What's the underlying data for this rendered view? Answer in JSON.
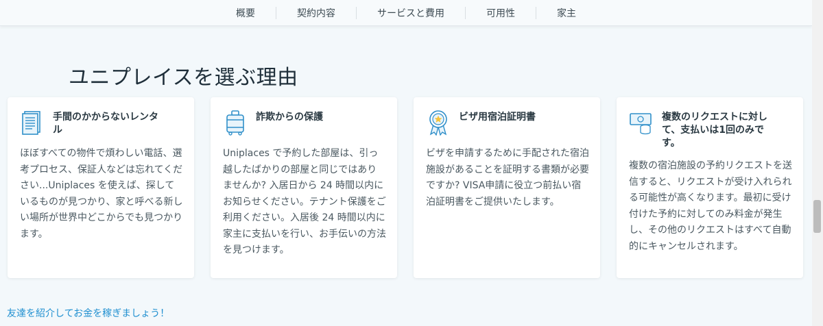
{
  "nav": {
    "items": [
      "概要",
      "契約内容",
      "サービスと費用",
      "可用性",
      "家主"
    ]
  },
  "section": {
    "title": "ユニプレイスを選ぶ理由"
  },
  "cards": [
    {
      "icon": "document-icon",
      "title": "手間のかからないレンタル",
      "body": "ほぼすべての物件で煩わしい電話、選考プロセス、保証人などは忘れてください...Uniplaces を使えば、探しているものが見つかり、家と呼べる新しい場所が世界中どこからでも見つかります。"
    },
    {
      "icon": "luggage-icon",
      "title": "詐欺からの保護",
      "body": "Uniplaces で予約した部屋は、引っ越したばかりの部屋と同じではありませんか? 入居日から 24 時間以内にお知らせください。テナント保護をご利用ください。入居後 24 時間以内に家主に支払いを行い、お手伝いの方法を見つけます。"
    },
    {
      "icon": "award-badge-icon",
      "title": "ビザ用宿泊証明書",
      "body": "ビザを申請するために手配された宿泊施設があることを証明する書類が必要ですか? VISA申請に役立つ前払い宿泊証明書をご提供いたします。"
    },
    {
      "icon": "money-icon",
      "title": "複数のリクエストに対して、支払いは1回のみです。",
      "body": "複数の宿泊施設の予約リクエストを送信すると、リクエストが受け入れられる可能性が高くなります。最初に受け付けた予約に対してのみ料金が発生し、その他のリクエストはすべて自動的にキャンセルされます。"
    }
  ],
  "referral": {
    "label": "友達を紹介してお金を稼ぎましょう！"
  },
  "colors": {
    "page_bg": "#f3f8fb",
    "icon_blue": "#2f8fc9",
    "link": "#1f8fd0",
    "badge_gold": "#f5c33b"
  }
}
